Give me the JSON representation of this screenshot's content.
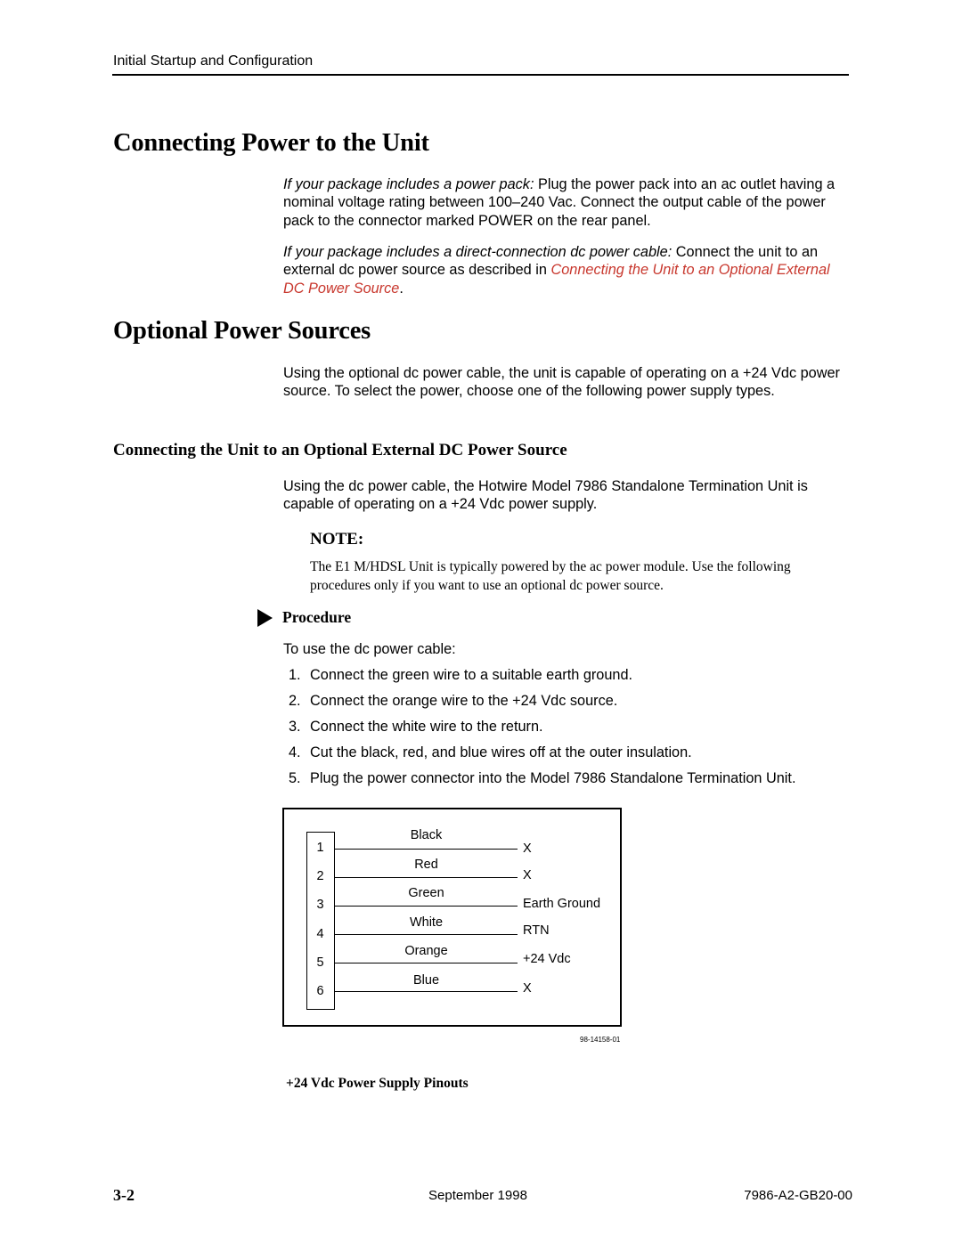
{
  "running_head": "Initial Startup and Configuration",
  "section1": {
    "title": "Connecting Power to the Unit",
    "para1": {
      "lead": "If your package includes a power pack:",
      "text": " Plug the power pack into an ac outlet having a nominal voltage rating between 100–240 Vac. Connect the output cable of the power pack to the connector marked POWER on the rear panel."
    },
    "para2": {
      "lead": "If your package includes a direct-connection dc power cable:",
      "text": " Connect the unit to an external dc power source as described in ",
      "link": "Connecting the Unit to an Optional External DC Power Source",
      "end": "."
    }
  },
  "section2": {
    "title": "Optional Power Sources",
    "para": "Using the optional dc power cable, the unit is capable of operating on a +24 Vdc power source. To select the power, choose one of the following power supply types."
  },
  "subsection": {
    "title": "Connecting the Unit to an Optional External DC Power Source",
    "para": "Using the dc power cable, the Hotwire Model 7986 Standalone Termination Unit is capable of operating on a +24 Vdc power supply.",
    "note_title": "NOTE:",
    "note_text": "The E1 M/HDSL Unit is typically powered by the ac power module. Use the following procedures only if you want to use an optional dc power source.",
    "procedure_label": "Procedure",
    "procedure_intro": "To use the dc power cable:",
    "steps": [
      {
        "num": "1.",
        "text": "Connect the green wire to a suitable earth ground."
      },
      {
        "num": "2.",
        "text": "Connect the orange wire to the +24 Vdc source."
      },
      {
        "num": "3.",
        "text": "Connect the white wire to the return."
      },
      {
        "num": "4.",
        "text": "Cut the black, red, and blue wires off at the outer insulation."
      },
      {
        "num": "5.",
        "text": "Plug the power connector into the Model 7986 Standalone Termination Unit."
      }
    ]
  },
  "figure": {
    "pins": [
      {
        "pin": "1",
        "wire": "Black",
        "connection": "X"
      },
      {
        "pin": "2",
        "wire": "Red",
        "connection": "X"
      },
      {
        "pin": "3",
        "wire": "Green",
        "connection": "Earth Ground"
      },
      {
        "pin": "4",
        "wire": "White",
        "connection": "RTN"
      },
      {
        "pin": "5",
        "wire": "Orange",
        "connection": "+24 Vdc"
      },
      {
        "pin": "6",
        "wire": "Blue",
        "connection": "X"
      }
    ],
    "figure_id": "98-14158-01",
    "caption": "+24 Vdc Power Supply Pinouts"
  },
  "footer": {
    "folio": "3-2",
    "date": "September 1998",
    "doc_number": "7986-A2-GB20-00"
  }
}
